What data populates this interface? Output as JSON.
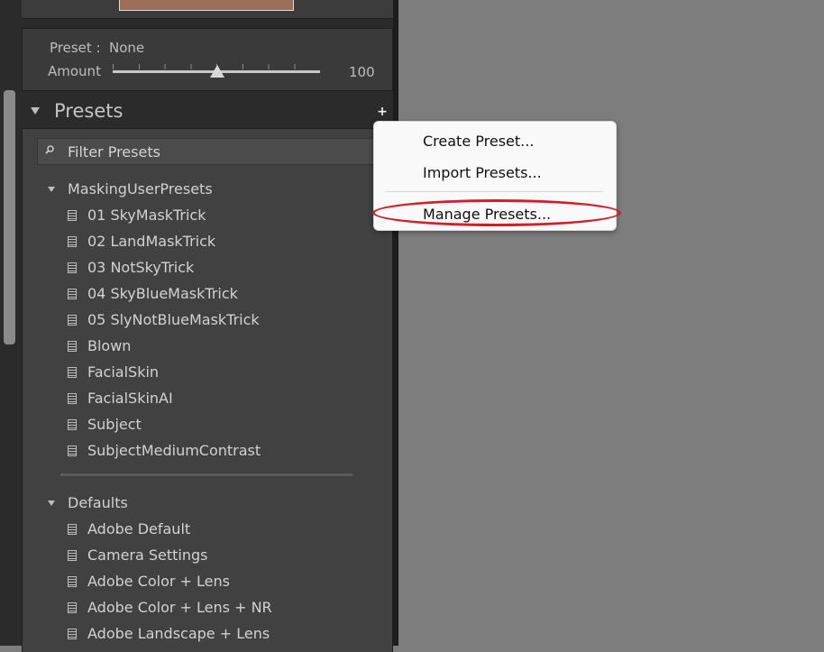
{
  "preset_box": {
    "preset_label": "Preset :",
    "preset_value": "None",
    "amount_label": "Amount",
    "amount_value": "100"
  },
  "presets_panel": {
    "title": "Presets",
    "filter_placeholder": "Filter Presets",
    "groups": [
      {
        "label": "MaskingUserPresets",
        "items": [
          "01 SkyMaskTrick",
          "02 LandMaskTrick",
          "03 NotSkyTrick",
          "04 SkyBlueMaskTrick",
          "05 SlyNotBlueMaskTrick",
          "Blown",
          "FacialSkin",
          "FacialSkinAI",
          "Subject",
          "SubjectMediumContrast"
        ]
      },
      {
        "label": "Defaults",
        "items": [
          "Adobe Default",
          "Camera Settings",
          "Adobe Color + Lens",
          "Adobe Color + Lens + NR",
          "Adobe Landscape + Lens"
        ]
      }
    ]
  },
  "context_menu": {
    "items": [
      "Create Preset...",
      "Import Presets...",
      "Manage Presets..."
    ],
    "highlight_color": "#d01f2a"
  },
  "icons": {
    "add": "plus-icon",
    "filter": "search-icon",
    "preset": "preset-icon",
    "collapse": "triangle-down-icon"
  }
}
